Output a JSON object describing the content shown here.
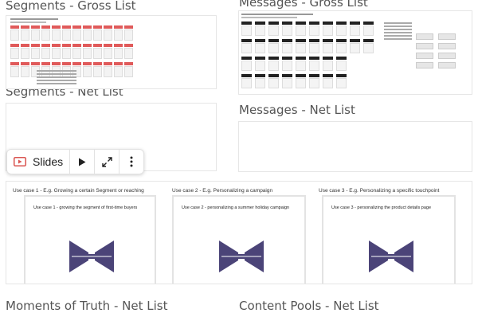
{
  "boards": {
    "segments_gross": {
      "title": "Segments - Gross List"
    },
    "segments_net": {
      "title": "Segments - Net List"
    },
    "messages_gross": {
      "title": "Messages - Gross List"
    },
    "messages_net": {
      "title": "Messages - Net List"
    },
    "moments_net": {
      "title": "Moments of Truth - Net List"
    },
    "content_net": {
      "title": "Content Pools - Net List"
    }
  },
  "toolbar": {
    "slides_label": "Slides",
    "icons": [
      "slides-icon",
      "play-icon",
      "expand-icon",
      "more-vert-icon"
    ]
  },
  "use_cases": [
    {
      "heading": "Use case 1 - E.g. Growing a certain Segment or reaching",
      "caption": "Use case 1 - growing the segment of first-time buyers"
    },
    {
      "heading": "Use case 2 - E.g. Personalizing a campaign",
      "caption": "Use case 2 - personalizing a summer holiday campaign"
    },
    {
      "heading": "Use case 3 - E.g. Personalizing a specific touchpoint",
      "caption": "Use case 3 - personalizing the product details page"
    }
  ],
  "colors": {
    "bowtie": "#4b4478",
    "segment_accent": "#e05a5a",
    "message_dark": "#222222"
  }
}
